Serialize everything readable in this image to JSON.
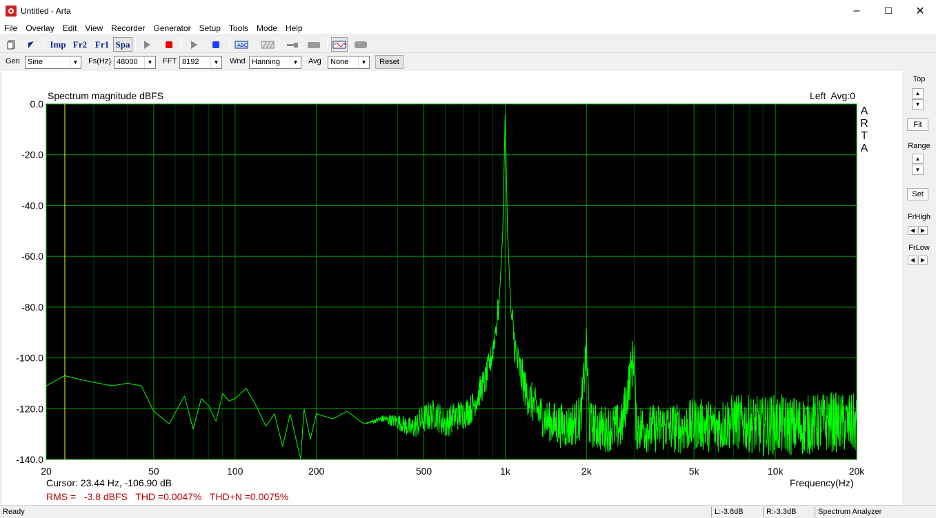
{
  "window": {
    "title": "Untitled - Arta"
  },
  "menu": [
    "File",
    "Overlay",
    "Edit",
    "View",
    "Recorder",
    "Generator",
    "Setup",
    "Tools",
    "Mode",
    "Help"
  ],
  "toolbar": {
    "imp": "Imp",
    "fr2": "Fr2",
    "fr1": "Fr1",
    "spa": "Spa"
  },
  "controls": {
    "gen_label": "Gen",
    "gen_value": "Sine",
    "fs_label": "Fs(Hz)",
    "fs_value": "48000",
    "fft_label": "FFT",
    "fft_value": "8192",
    "wnd_label": "Wnd",
    "wnd_value": "Hanning",
    "avg_label": "Avg",
    "avg_value": "None",
    "reset_label": "Reset"
  },
  "plot": {
    "title": "Spectrum magnitude dBFS",
    "channel": "Left  Avg:0",
    "watermark": [
      "A",
      "R",
      "T",
      "A"
    ],
    "cursor": "Cursor: 23.44 Hz, -106.90 dB",
    "measurements": "RMS =   -3.8 dBFS   THD =0.0047%   THD+N =0.0075%",
    "xlabel": "Frequency(Hz)"
  },
  "chart_data": {
    "type": "line",
    "title": "Spectrum magnitude dBFS",
    "xlabel": "Frequency(Hz)",
    "ylabel": "",
    "xscale": "log",
    "xlim": [
      20,
      20000
    ],
    "ylim": [
      -140,
      0
    ],
    "grid": true,
    "background": "#000000",
    "grid_color": "#00a000",
    "trace_color": "#00ff00",
    "cursor_color": "#ffff00",
    "cursor_x": 23.44,
    "x_ticks": [
      20,
      50,
      100,
      200,
      500,
      1000,
      2000,
      5000,
      10000,
      20000
    ],
    "x_tick_labels": [
      "20",
      "50",
      "100",
      "200",
      "500",
      "1k",
      "2k",
      "5k",
      "10k",
      "20k"
    ],
    "y_ticks": [
      0,
      -20,
      -40,
      -60,
      -80,
      -100,
      -120,
      -140
    ],
    "y_tick_labels": [
      "0.0",
      "-20.0",
      "-40.0",
      "-60.0",
      "-80.0",
      "-100.0",
      "-120.0",
      "-140.0"
    ],
    "series": [
      {
        "x": [
          20,
          23.4,
          28,
          35,
          40,
          45,
          50,
          57,
          65,
          70,
          75,
          80,
          85,
          90,
          95,
          100,
          110,
          120,
          130,
          140,
          150,
          160,
          175,
          180,
          190,
          200,
          230,
          260,
          300,
          350,
          400,
          450,
          500,
          550,
          600,
          650,
          700,
          750,
          800,
          850,
          900,
          950,
          980,
          1000,
          1020,
          1050,
          1100,
          1200,
          1300,
          1400,
          1500,
          1700,
          1900,
          2000,
          2050,
          2300,
          2700,
          3000,
          3050,
          3500,
          4000,
          4500,
          5000,
          6000,
          7000,
          8000,
          9000,
          10000,
          12000,
          14000,
          16000,
          18000,
          20000
        ],
        "y": [
          -111,
          -107,
          -109,
          -111,
          -110,
          -111,
          -121,
          -126,
          -115,
          -128,
          -116,
          -119,
          -125,
          -114,
          -117,
          -116,
          -112,
          -119,
          -127,
          -122,
          -135,
          -122,
          -140,
          -120,
          -132,
          -122,
          -124,
          -121,
          -126,
          -124,
          -125,
          -128,
          -124,
          -122,
          -126,
          -123,
          -122,
          -120,
          -114,
          -108,
          -97,
          -78,
          -50,
          -3,
          -50,
          -82,
          -100,
          -114,
          -120,
          -124,
          -126,
          -127,
          -124,
          -96,
          -126,
          -128,
          -127,
          -98,
          -127,
          -128,
          -127,
          -128,
          -126,
          -127,
          -125,
          -126,
          -127,
          -126,
          -127,
          -126,
          -125,
          -126,
          -126
        ]
      }
    ]
  },
  "rightpanel": {
    "top_label": "Top",
    "fit_label": "Fit",
    "range_label": "Range",
    "set_label": "Set",
    "frhigh_label": "FrHigh",
    "frlow_label": "FrLow"
  },
  "status": {
    "ready": "Ready",
    "left_level": "L:-3.8dB",
    "right_level": "R:-3.3dB",
    "mode": "Spectrum Analyzer"
  }
}
